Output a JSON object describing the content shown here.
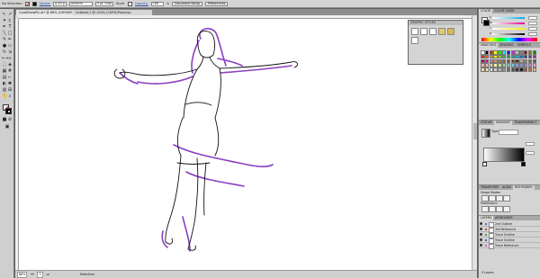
{
  "control_bar": {
    "selection": "No Selection",
    "stroke_label": "Stroke:",
    "stroke_value": "0.25 p",
    "uniform": "Uniform",
    "brush": "5 pt. Oval",
    "style_label": "Style:",
    "opacity_label": "Opacity:",
    "opacity_value": "100",
    "percent": "%",
    "doc_setup": "Document Setup",
    "preferences": "Preferences"
  },
  "doc_tabs": [
    "CorelDrawPic.ai* @ 66% (CMYK/Preview)",
    "Untitled-1 @ 100% (CMYK/Preview)"
  ],
  "graphic_styles": {
    "title": "GRAPHIC STYLES"
  },
  "color_panel": {
    "tabs": [
      "COLOR",
      "COLOR GUIDE"
    ],
    "channels": [
      "C",
      "M",
      "Y",
      "K"
    ]
  },
  "swatches_panel": {
    "tabs": [
      "SWATCHES",
      "BRUSHES",
      "SYMBOLS"
    ]
  },
  "gradient_panel": {
    "tabs": [
      "STROKE",
      "GRADIENT",
      "TRANSPARENCY"
    ],
    "type_label": "Type:"
  },
  "pathfinder_panel": {
    "tabs": [
      "TRANSFORM",
      "ALIGN",
      "PATHFINDER"
    ],
    "shape_modes": "Shape Modes:",
    "pathfinders": "Pathfinders:"
  },
  "layers_panel": {
    "tabs": [
      "LAYERS",
      "ARTBOARDS"
    ],
    "layers": [
      {
        "name": "2nd Outline",
        "color": "#4f6ef0"
      },
      {
        "name": "3rd Reference",
        "color": "#e23a3a"
      },
      {
        "name": "Trace Outline",
        "color": "#39b04a"
      },
      {
        "name": "Trace Outline",
        "color": "#3a5ee2"
      },
      {
        "name": "Trace Reference",
        "color": "#e04fd0"
      }
    ],
    "footer": "5 Layers"
  },
  "status_bar": {
    "zoom": "66%",
    "page": "1",
    "mode": "Selection"
  },
  "colors": {
    "accent_purple": "#8a3fc0",
    "line_black": "#111111"
  }
}
